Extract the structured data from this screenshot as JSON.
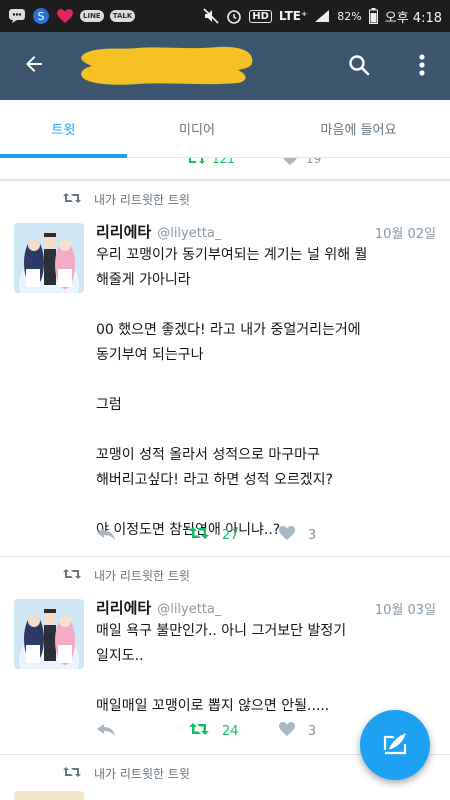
{
  "status_bar": {
    "icons": [
      "message-icon",
      "samsung-s-icon",
      "heart-icon",
      "line-app-icon",
      "talk-app-icon",
      "mute-icon",
      "alarm-icon",
      "hd-voice-icon",
      "lte-icon",
      "signal-icon",
      "battery-icon"
    ],
    "line_label": "LINE",
    "talk_label": "TALK",
    "hd_label": "HD",
    "network": "LTE⁺",
    "battery": "82%",
    "time": "오후 4:18"
  },
  "app_bar": {
    "color": "#3c5670",
    "title_redaction_color": "#f5c124"
  },
  "tabs": [
    {
      "label": "트윗",
      "selected": true
    },
    {
      "label": "미디어",
      "selected": false
    },
    {
      "label": "마음에 들어요",
      "selected": false
    }
  ],
  "previous_tweet": {
    "retweets": "121",
    "likes": "19"
  },
  "tweets": [
    {
      "retweet_label": "내가 리트윗한 트윗",
      "name": "리리에타",
      "handle": "@lilyetta_",
      "date": "10월 02일",
      "lines": [
        "우리 꼬맹이가 동기부여되는 계기는 널 위해 뭘",
        "해줄게 가아니라",
        "",
        "00 했으면 좋겠다! 라고 내가 중얼거리는거에",
        "동기부여 되는구나",
        "",
        "그럼",
        "",
        "꼬맹이 성적 올라서 성적으로 마구마구",
        "해버리고싶다! 라고 하면 성적 오르겠지?",
        "",
        "야 이정도면 참된연애 아니냐..?"
      ],
      "retweets": "27",
      "likes": "3"
    },
    {
      "retweet_label": "내가 리트윗한 트윗",
      "name": "리리에타",
      "handle": "@lilyetta_",
      "date": "10월 03일",
      "lines": [
        "매일 욕구 불만인가.. 아니 그거보단 발정기",
        "일지도..",
        "",
        "매일매일 꼬맹이로 뽑지 않으면 안될....."
      ],
      "retweets": "24",
      "likes": "3"
    },
    {
      "retweet_label": "내가 리트윗한 트윗"
    }
  ],
  "colors": {
    "accent": "#1da1f2",
    "retweet_green": "#17bf63",
    "muted": "#8899a6"
  }
}
